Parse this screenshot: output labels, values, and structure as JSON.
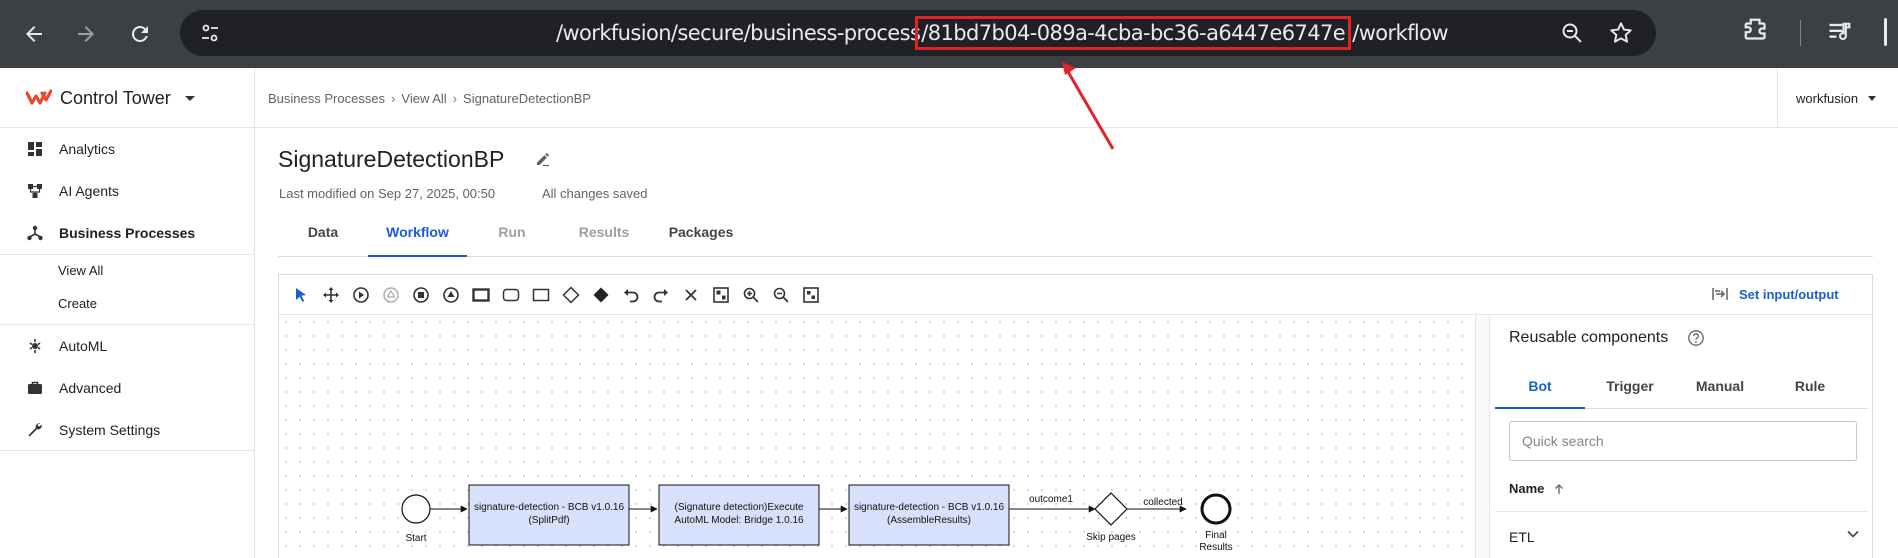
{
  "browser": {
    "url_prefix": "/workfusion/secure/business-process",
    "url_id": "/81bd7b04-089a-4cba-bc36-a6447e6747e",
    "url_suffix": " /workflow"
  },
  "header": {
    "brand": "Control Tower",
    "breadcrumb": [
      "Business Processes",
      "View All",
      "SignatureDetectionBP"
    ],
    "user": "workfusion",
    "brand_color": "#e8482c"
  },
  "sidebar": {
    "items": [
      "Analytics",
      "AI Agents",
      "Business Processes",
      "AutoML",
      "Advanced",
      "System Settings"
    ],
    "subitems": [
      "View All",
      "Create"
    ]
  },
  "main": {
    "title": "SignatureDetectionBP",
    "last_modified": "Last modified on Sep 27, 2025, 00:50",
    "saved": "All changes saved",
    "tabs": [
      "Data",
      "Workflow",
      "Run",
      "Results",
      "Packages"
    ],
    "active_tab": "Workflow"
  },
  "editor": {
    "set_io": "Set input/output",
    "accent": "#1a5fd1"
  },
  "workflow": {
    "start": "Start",
    "tasks": [
      [
        "signature-detection - BCB v1.0.16",
        "(SplitPdf)"
      ],
      [
        "(Signature detection)Execute",
        "AutoML Model: Bridge 1.0.16"
      ],
      [
        "signature-detection - BCB v1.0.16",
        "(AssembleResults)"
      ]
    ],
    "outcome": "outcome1",
    "gateway": "Skip pages",
    "collected": "collected",
    "end": [
      "Final",
      "Results"
    ]
  },
  "panel": {
    "title": "Reusable components",
    "tabs": [
      "Bot",
      "Trigger",
      "Manual",
      "Rule"
    ],
    "search_placeholder": "Quick search",
    "column": "Name",
    "rows": [
      "ETL"
    ]
  }
}
